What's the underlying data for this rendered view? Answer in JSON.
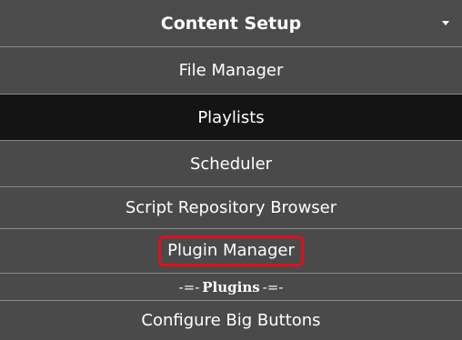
{
  "menu": {
    "title": "Content Setup",
    "items": [
      {
        "label": "File Manager"
      },
      {
        "label": "Playlists"
      },
      {
        "label": "Scheduler"
      },
      {
        "label": "Script Repository Browser"
      },
      {
        "label": "Plugin Manager"
      }
    ],
    "plugins_divider": {
      "prefix": "-=-",
      "label": "Plugins",
      "suffix": "-=-"
    },
    "plugin_items": [
      {
        "label": "Configure Big Buttons"
      }
    ],
    "active_item": "Playlists",
    "highlighted_item": "Plugin Manager"
  },
  "colors": {
    "menu_background": "#4a4a4a",
    "active_background": "#141414",
    "divider": "#8a8a8a",
    "highlight": "#e0101c",
    "text": "#ffffff"
  }
}
